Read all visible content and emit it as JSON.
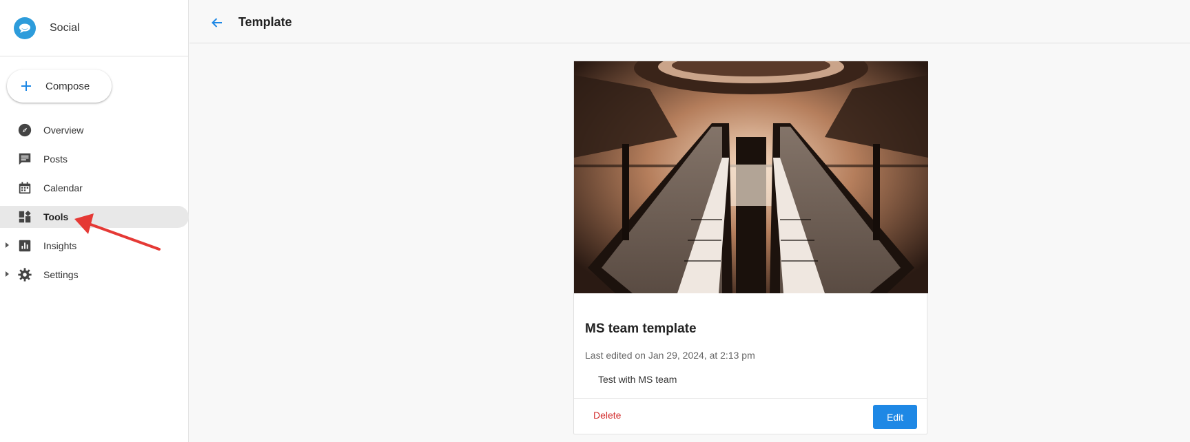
{
  "app": {
    "name": "Social"
  },
  "sidebar": {
    "compose_label": "Compose",
    "items": [
      {
        "label": "Overview",
        "icon": "compass-icon"
      },
      {
        "label": "Posts",
        "icon": "posts-icon"
      },
      {
        "label": "Calendar",
        "icon": "calendar-icon"
      },
      {
        "label": "Tools",
        "icon": "tools-icon",
        "active": true
      },
      {
        "label": "Insights",
        "icon": "insights-icon",
        "expandable": true
      },
      {
        "label": "Settings",
        "icon": "gear-icon",
        "expandable": true
      }
    ]
  },
  "header": {
    "title": "Template"
  },
  "template_card": {
    "title": "MS team template",
    "meta": "Last edited on Jan 29, 2024, at 2:13 pm",
    "body": "Test with MS team",
    "delete_label": "Delete",
    "edit_label": "Edit"
  },
  "colors": {
    "accent": "#1e88e5",
    "brand": "#2d9cdb",
    "danger": "#d32f2f",
    "annotation": "#e53935"
  }
}
